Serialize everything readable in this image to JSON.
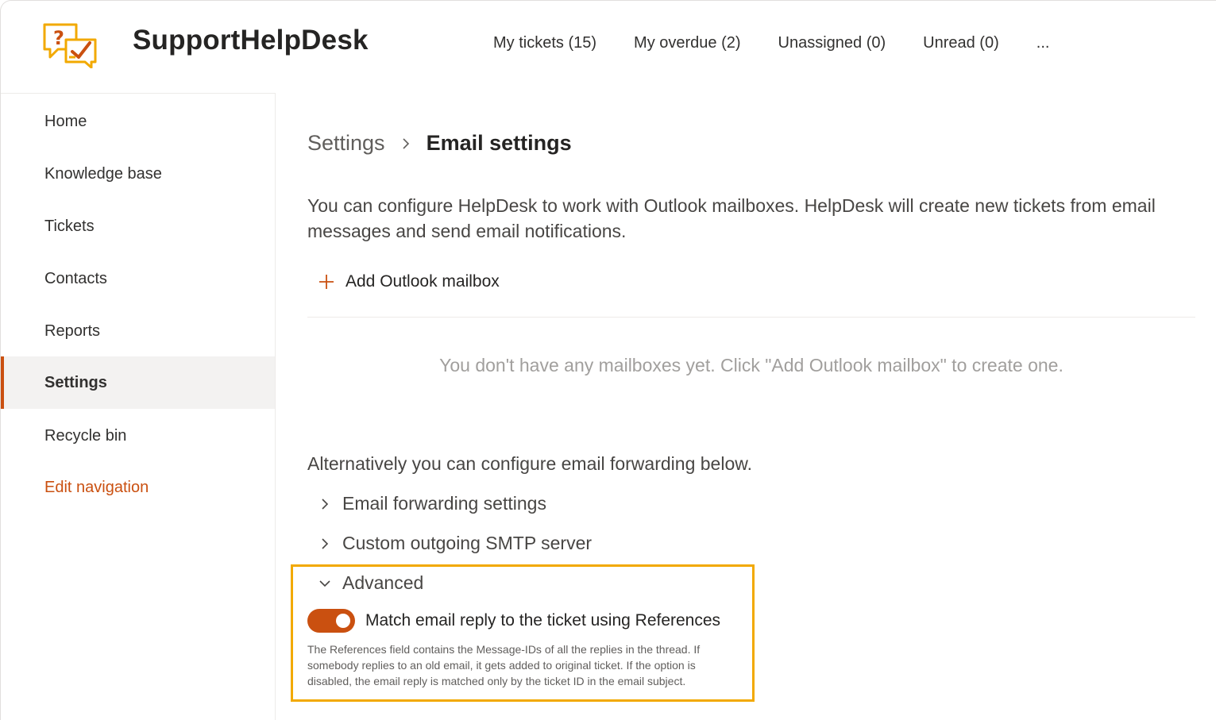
{
  "app": {
    "title": "SupportHelpDesk",
    "accent_color": "#ca5010",
    "logo_color": "#f2a900"
  },
  "topnav": {
    "items": [
      {
        "label": "My tickets (15)"
      },
      {
        "label": "My overdue (2)"
      },
      {
        "label": "Unassigned (0)"
      },
      {
        "label": "Unread (0)"
      }
    ],
    "more_label": "..."
  },
  "sidebar": {
    "items": [
      {
        "label": "Home"
      },
      {
        "label": "Knowledge base"
      },
      {
        "label": "Tickets"
      },
      {
        "label": "Contacts"
      },
      {
        "label": "Reports"
      },
      {
        "label": "Settings",
        "active": true
      },
      {
        "label": "Recycle bin"
      }
    ],
    "edit_label": "Edit navigation"
  },
  "main": {
    "breadcrumb": {
      "parent": "Settings",
      "current": "Email settings"
    },
    "intro": "You can configure HelpDesk to work with Outlook mailboxes. HelpDesk will create new tickets from email messages and send email notifications.",
    "add_mailbox_label": "Add Outlook mailbox",
    "empty_message": "You don't have any mailboxes yet. Click \"Add Outlook mailbox\" to create one.",
    "alternative_text": "Alternatively you can configure email forwarding below.",
    "sections": {
      "forwarding": "Email forwarding settings",
      "smtp": "Custom outgoing SMTP server",
      "advanced": "Advanced"
    },
    "advanced": {
      "toggle_label": "Match email reply to the ticket using References",
      "toggle_on": true,
      "help_text": "The References field contains the Message-IDs of all the replies in the thread. If somebody replies to an old email, it gets added to original ticket. If the option is disabled, the email reply is matched only by the ticket ID in the email subject."
    }
  }
}
